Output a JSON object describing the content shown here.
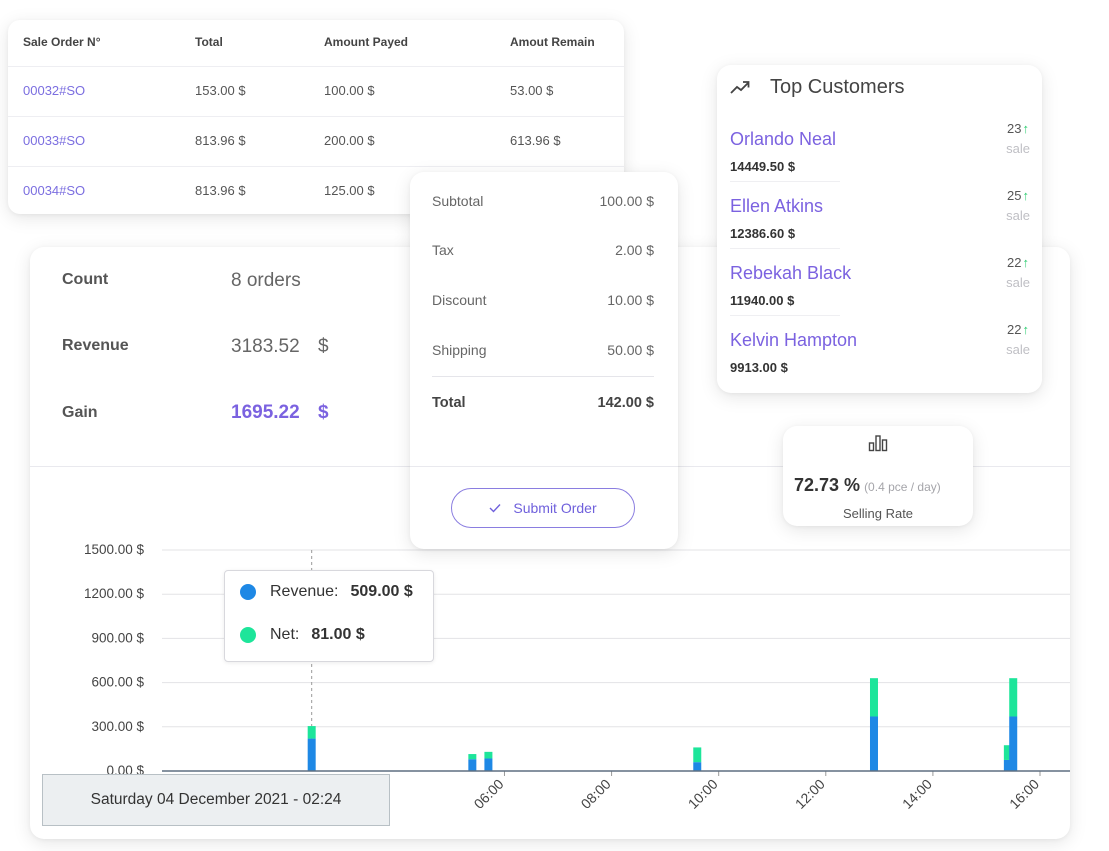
{
  "orders_table": {
    "headers": [
      "Sale Order N°",
      "Total",
      "Amount Payed",
      "Amout Remain"
    ],
    "rows": [
      [
        "00032#SO",
        "153.00 $",
        "100.00 $",
        "53.00 $"
      ],
      [
        "00033#SO",
        "813.96 $",
        "200.00 $",
        "613.96 $"
      ],
      [
        "00034#SO",
        "813.96 $",
        "125.00 $",
        ""
      ]
    ]
  },
  "stats": {
    "count_label": "Count",
    "count_value": "8 orders",
    "revenue_label": "Revenue",
    "revenue_value": "3183.52",
    "revenue_currency": "$",
    "gain_label": "Gain",
    "gain_value": "1695.22",
    "gain_currency": "$"
  },
  "summary": {
    "subtotal_label": "Subtotal",
    "subtotal_value": "100.00 $",
    "tax_label": "Tax",
    "tax_value": "2.00 $",
    "discount_label": "Discount",
    "discount_value": "10.00 $",
    "shipping_label": "Shipping",
    "shipping_value": "50.00 $",
    "total_label": "Total",
    "total_value": "142.00 $",
    "submit_label": "Submit Order"
  },
  "customers": {
    "title": "Top Customers",
    "sale_label": "sale",
    "items": [
      {
        "name": "Orlando Neal",
        "amount": "14449.50 $",
        "count": "23"
      },
      {
        "name": "Ellen Atkins",
        "amount": "12386.60 $",
        "count": "25"
      },
      {
        "name": "Rebekah Black",
        "amount": "11940.00 $",
        "count": "22"
      },
      {
        "name": "Kelvin Hampton",
        "amount": "9913.00 $",
        "count": "22"
      }
    ]
  },
  "selling_rate": {
    "value": "72.73 %",
    "detail": "(0.4 pce / day)",
    "label": "Selling Rate"
  },
  "tooltip": {
    "revenue_label": "Revenue:",
    "revenue_value": "509.00 $",
    "net_label": "Net:",
    "net_value": "81.00 $"
  },
  "hover_date": "Saturday 04 December 2021 - 02:24",
  "chart_data": {
    "type": "bar",
    "stacked": true,
    "y_ticks": [
      "1500.00 $",
      "1200.00 $",
      "900.00 $",
      "600.00 $",
      "300.00 $",
      "0.00 $"
    ],
    "ylim": [
      0,
      1500
    ],
    "x_ticks": [
      "06:00",
      "08:00",
      "10:00",
      "12:00",
      "14:00",
      "16:00"
    ],
    "x_range_hours": [
      0.8,
      16.0
    ],
    "series": [
      {
        "name": "Revenue",
        "color": "#1e88e5"
      },
      {
        "name": "Net",
        "color": "#1de59a"
      }
    ],
    "bars": [
      {
        "x": 2.4,
        "revenue": 220,
        "net": 85
      },
      {
        "x": 5.4,
        "revenue": 80,
        "net": 35
      },
      {
        "x": 5.7,
        "revenue": 85,
        "net": 45
      },
      {
        "x": 9.6,
        "revenue": 60,
        "net": 100
      },
      {
        "x": 12.9,
        "revenue": 370,
        "net": 260
      },
      {
        "x": 15.4,
        "revenue": 75,
        "net": 100
      },
      {
        "x": 15.5,
        "revenue": 370,
        "net": 260
      }
    ],
    "hover_x": 2.4,
    "grid": true
  }
}
